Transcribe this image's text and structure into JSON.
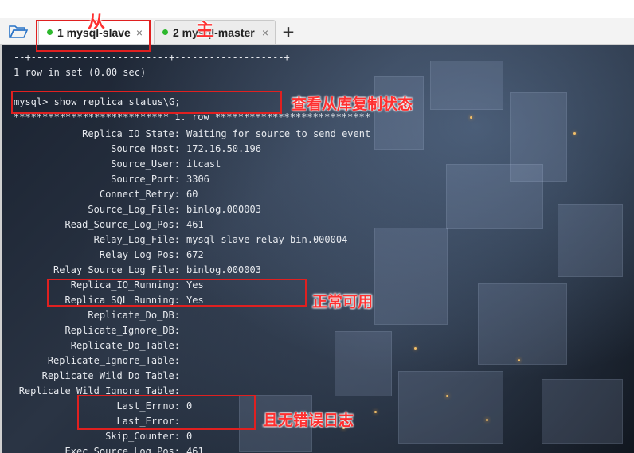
{
  "tabs": [
    {
      "label": "1 mysql-slave",
      "close": "×",
      "status_color": "#2db82d"
    },
    {
      "label": "2 mysql-master",
      "close": "×",
      "status_color": "#2db82d"
    }
  ],
  "add_tab": "+",
  "terminal": {
    "border_line": "--+------------------------+-------------------+",
    "row_count": "1 row in set (0.00 sec)",
    "command": "mysql> show replica status\\G;",
    "row_header": "*************************** 1. row ***************************",
    "fields": [
      {
        "key": "Replica_IO_State:",
        "value": "Waiting for source to send event"
      },
      {
        "key": "Source_Host:",
        "value": "172.16.50.196"
      },
      {
        "key": "Source_User:",
        "value": "itcast"
      },
      {
        "key": "Source_Port:",
        "value": "3306"
      },
      {
        "key": "Connect_Retry:",
        "value": "60"
      },
      {
        "key": "Source_Log_File:",
        "value": "binlog.000003"
      },
      {
        "key": "Read_Source_Log_Pos:",
        "value": "461"
      },
      {
        "key": "Relay_Log_File:",
        "value": "mysql-slave-relay-bin.000004"
      },
      {
        "key": "Relay_Log_Pos:",
        "value": "672"
      },
      {
        "key": "Relay_Source_Log_File:",
        "value": "binlog.000003"
      },
      {
        "key": "Replica_IO_Running:",
        "value": "Yes"
      },
      {
        "key": "Replica_SQL_Running:",
        "value": "Yes"
      },
      {
        "key": "Replicate_Do_DB:",
        "value": ""
      },
      {
        "key": "Replicate_Ignore_DB:",
        "value": ""
      },
      {
        "key": "Replicate_Do_Table:",
        "value": ""
      },
      {
        "key": "Replicate_Ignore_Table:",
        "value": ""
      },
      {
        "key": "Replicate_Wild_Do_Table:",
        "value": ""
      },
      {
        "key": "Replicate_Wild_Ignore_Table:",
        "value": ""
      },
      {
        "key": "Last_Errno:",
        "value": "0"
      },
      {
        "key": "Last_Error:",
        "value": ""
      },
      {
        "key": "Skip_Counter:",
        "value": "0"
      },
      {
        "key": "Exec_Source_Log_Pos:",
        "value": "461"
      }
    ]
  },
  "annotations": {
    "slave_label": "从",
    "master_label": "主",
    "check_status": "查看从库复制状态",
    "running_ok": "正常可用",
    "no_error": "且无错误日志"
  },
  "colors": {
    "annotation": "#e02020",
    "running_dot": "#2db82d"
  }
}
